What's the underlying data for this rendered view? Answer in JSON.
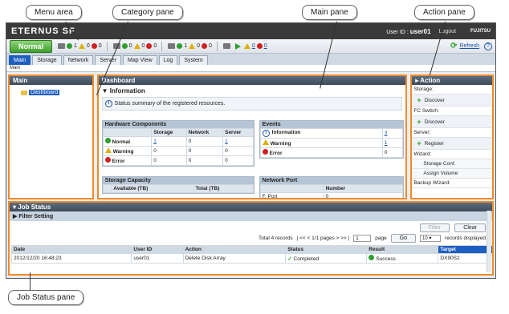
{
  "callouts": {
    "menu_area": "Menu area",
    "category_pane": "Category pane",
    "main_pane": "Main pane",
    "action_pane": "Action pane",
    "job_status_pane": "Job Status pane"
  },
  "header": {
    "brand": "ETERNUS SF",
    "user_label": "User ID : ",
    "user_id": "user01",
    "logout": "Logout",
    "vendor": "FUJITSU"
  },
  "statusbar": {
    "status": "Normal",
    "groups": [
      {
        "ok": "1",
        "warn": "0",
        "err": "0"
      },
      {
        "ok": "0",
        "warn": "0",
        "err": "0"
      },
      {
        "ok": "1",
        "warn": "0",
        "err": "0"
      },
      {
        "warn": "0",
        "err": "0"
      }
    ],
    "refresh": "Refresh"
  },
  "tabs": [
    "Main",
    "Storage",
    "Network",
    "Server",
    "Map View",
    "Log",
    "System"
  ],
  "breadcrumb": "Main",
  "category": {
    "title": "Main",
    "item": "Dashboard"
  },
  "main": {
    "title": "Dashboard",
    "section": "Information",
    "info": "Status summary of the registered resources.",
    "hw": {
      "title": "Hardware Components",
      "cols": [
        "",
        "Storage",
        "Network",
        "Server"
      ],
      "rows": [
        {
          "label": "Normal",
          "v": [
            "1",
            "0",
            "1"
          ]
        },
        {
          "label": "Warning",
          "v": [
            "0",
            "0",
            "0"
          ]
        },
        {
          "label": "Error",
          "v": [
            "0",
            "0",
            "0"
          ]
        }
      ]
    },
    "events": {
      "title": "Events",
      "rows": [
        {
          "label": "Information",
          "v": "3"
        },
        {
          "label": "Warning",
          "v": "1"
        },
        {
          "label": "Error",
          "v": "0"
        }
      ]
    },
    "capacity": {
      "title": "Storage Capacity",
      "cols": [
        "Available (TB)",
        "Total (TB)"
      ]
    },
    "network_port": {
      "title": "Network Port",
      "col": "Number",
      "row_label": "F. Port",
      "row_value": "0"
    }
  },
  "action": {
    "title": "Action",
    "rows": [
      {
        "type": "cat",
        "text": "Storage:"
      },
      {
        "type": "btn",
        "text": "Discover"
      },
      {
        "type": "cat",
        "text": "FC Switch:"
      },
      {
        "type": "btn",
        "text": "Discover"
      },
      {
        "type": "cat",
        "text": "Server:"
      },
      {
        "type": "btn",
        "text": "Register"
      },
      {
        "type": "cat",
        "text": "Wizard:"
      },
      {
        "type": "sub",
        "text": "Storage Conf."
      },
      {
        "type": "sub",
        "text": "Assign Volume"
      },
      {
        "type": "cat",
        "text": "Backup Wizard:"
      }
    ]
  },
  "jobs": {
    "title": "Job Status",
    "filter": "Filter Setting",
    "filter_btn": "Filter",
    "clear_btn": "Clear",
    "total": "Total 4 records",
    "pages": "| << < 1/1 pages > >> |",
    "page_value": "1",
    "page_label": "page",
    "go": "Go",
    "per_page": "10",
    "records_displayed": "records displayed",
    "columns": [
      "Date",
      "User ID",
      "Action",
      "Status",
      "Result",
      "Target"
    ],
    "rows": [
      [
        "2012/12/20 16:48:23",
        "user01",
        "Delete Disk Array",
        "Completed",
        "Success",
        "DX90S2"
      ]
    ]
  }
}
